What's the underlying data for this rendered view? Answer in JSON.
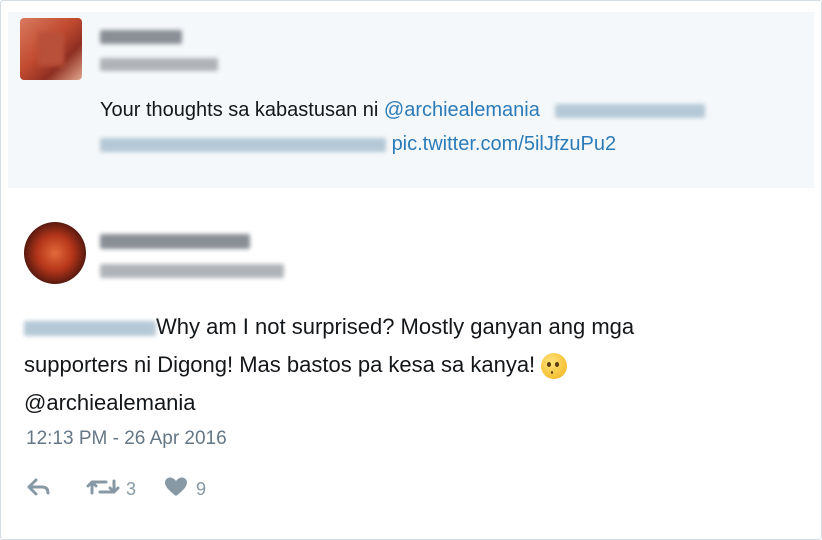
{
  "quoted_tweet": {
    "text_line1_prefix": "Your thoughts sa kabastusan ni ",
    "mention": "@archiealemania",
    "pic_link": "pic.twitter.com/5ilJfzuPu2"
  },
  "reply_tweet": {
    "line1": "Why am I not surprised? Mostly ganyan ang mga",
    "line2": "supporters ni Digong! Mas bastos pa kesa sa kanya!",
    "mention": "@archiealemania",
    "timestamp": "12:13 PM - 26 Apr 2016",
    "retweet_count": "3",
    "like_count": "9",
    "emoji": "face-with-rolling-eyes"
  },
  "colors": {
    "link": "#2b7bb9",
    "text": "#14171a",
    "muted": "#657786",
    "quoted_bg": "#f5f8fa"
  },
  "icons": [
    "reply-icon",
    "retweet-icon",
    "like-icon"
  ]
}
